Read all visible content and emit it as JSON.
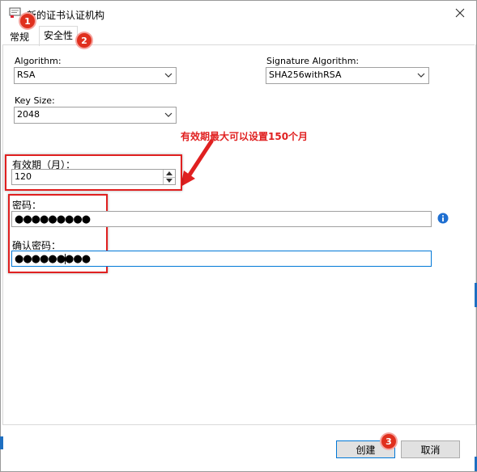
{
  "window": {
    "title": "新的证书认证机构"
  },
  "tabs": [
    {
      "label": "常规"
    },
    {
      "label": "安全性"
    }
  ],
  "form": {
    "algorithm": {
      "label": "Algorithm:",
      "value": "RSA"
    },
    "signature_algorithm": {
      "label": "Signature Algorithm:",
      "value": "SHA256withRSA"
    },
    "key_size": {
      "label": "Key Size:",
      "value": "2048"
    },
    "validity": {
      "label": "有效期（月）：",
      "value": "120"
    },
    "password": {
      "label": "密码：",
      "value": "●●●●●●●●●"
    },
    "confirm_password": {
      "label": "确认密码：",
      "value": "●●●●●●●●●"
    }
  },
  "annotation": {
    "text": "有效期最大可以设置150个月",
    "color": "#e02020"
  },
  "badges": [
    "1",
    "2",
    "3"
  ],
  "buttons": {
    "create": "创建",
    "cancel": "取消"
  },
  "icons": [
    "app-icon",
    "close-icon",
    "chevron-down-icon",
    "spin-up-icon",
    "spin-down-icon",
    "info-icon",
    "arrow-icon"
  ]
}
